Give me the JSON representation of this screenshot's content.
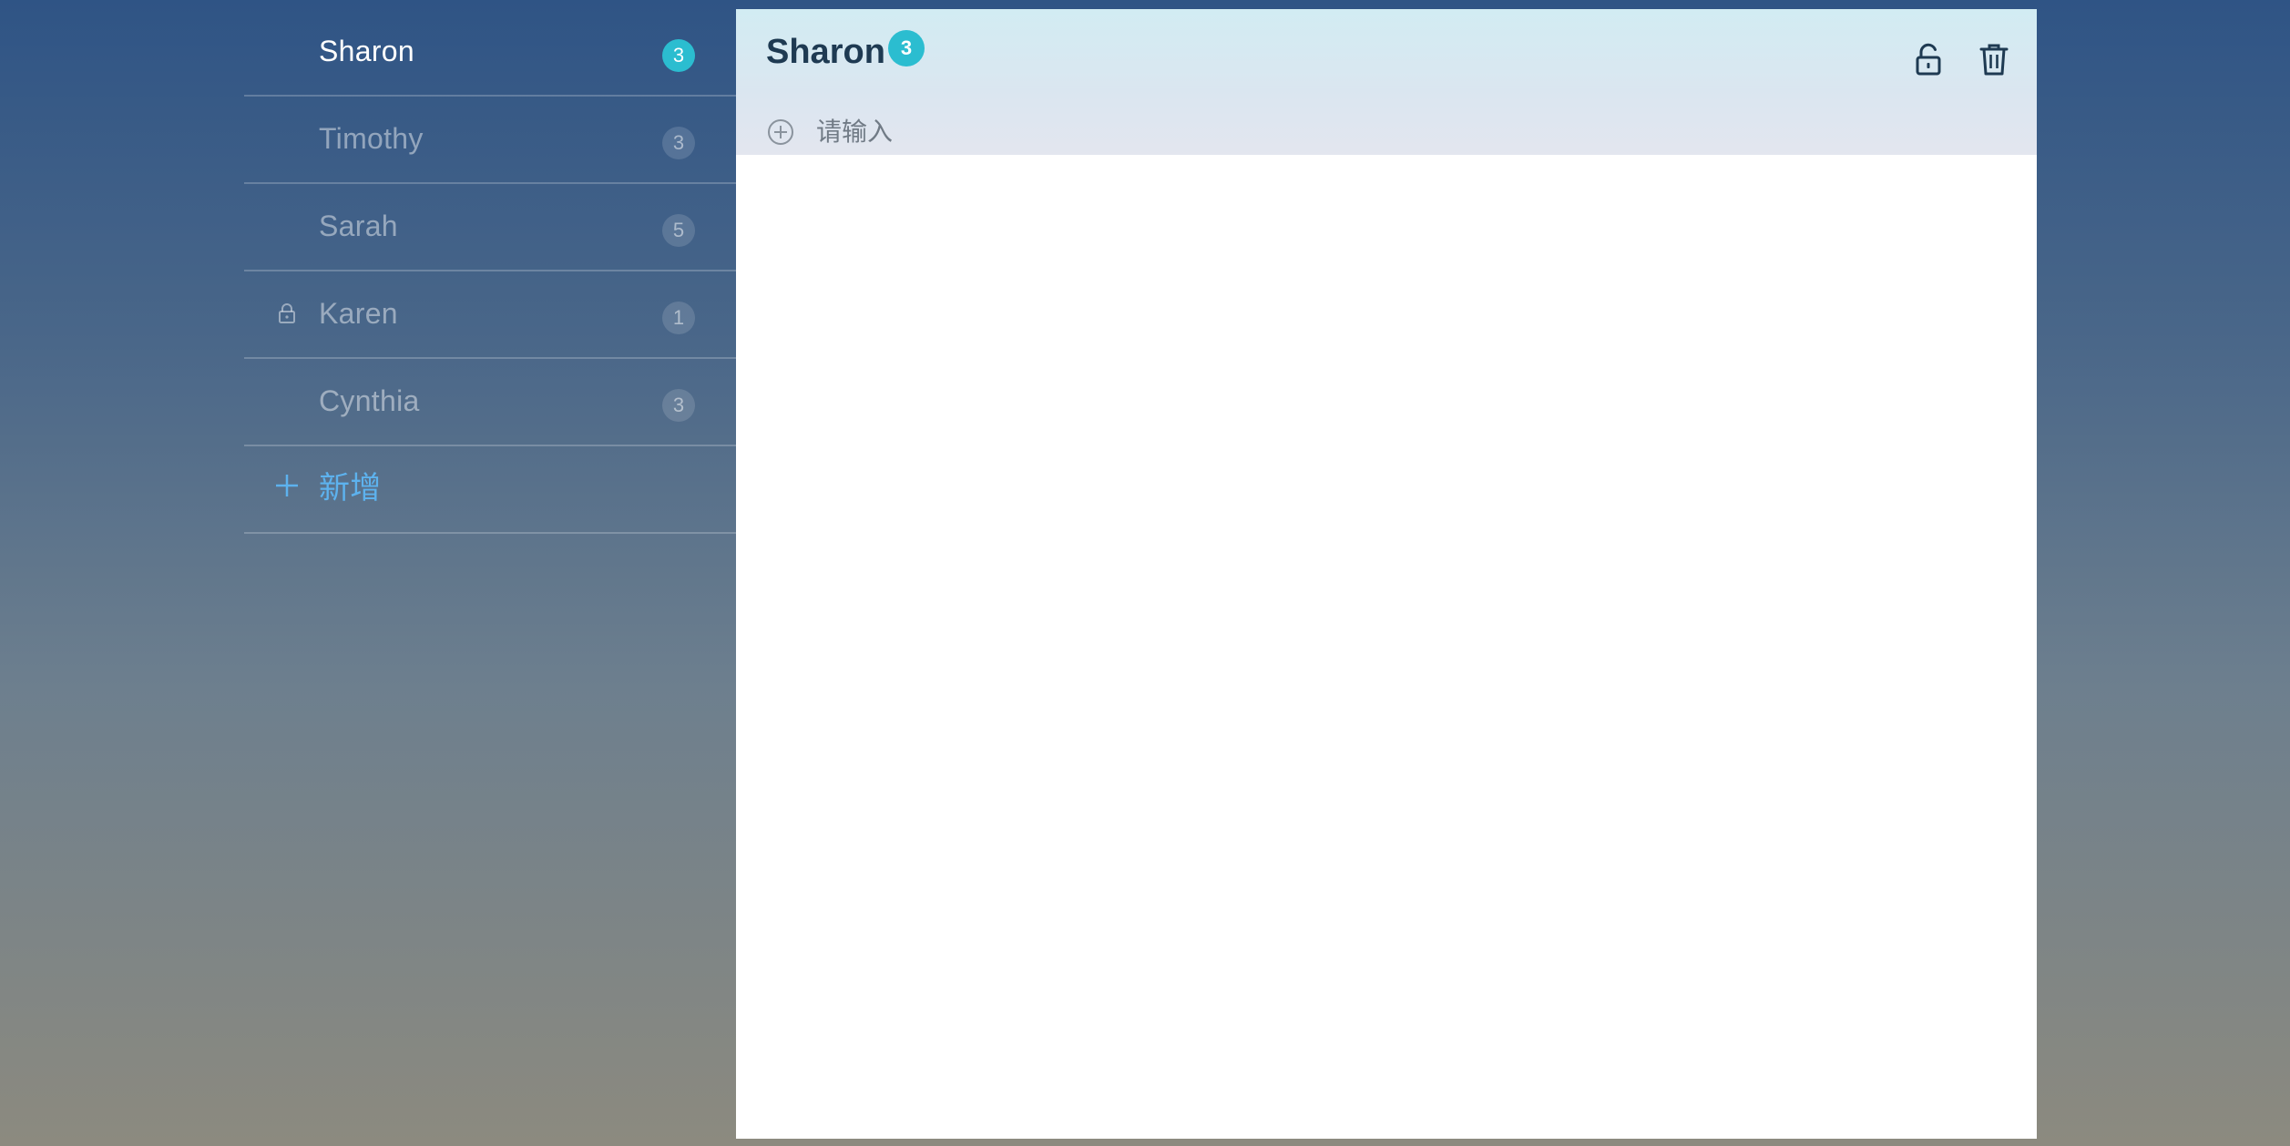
{
  "sidebar": {
    "items": [
      {
        "label": "Sharon",
        "count": "3",
        "active": true,
        "locked": false
      },
      {
        "label": "Timothy",
        "count": "3",
        "active": false,
        "locked": false
      },
      {
        "label": "Sarah",
        "count": "5",
        "active": false,
        "locked": false
      },
      {
        "label": "Karen",
        "count": "1",
        "active": false,
        "locked": true,
        "icon": "lock-icon"
      },
      {
        "label": "Cynthia",
        "count": "3",
        "active": false,
        "locked": false
      }
    ],
    "add_label": "新增",
    "add_icon": "plus-icon"
  },
  "main": {
    "title": "Sharon",
    "count": "3",
    "lock_icon": "unlock-icon",
    "delete_icon": "trash-icon",
    "input": {
      "placeholder": "请输入",
      "value": "",
      "icon": "add-circle-icon"
    }
  },
  "colors": {
    "accent": "#2bbdd0",
    "add_link": "#5db2ee",
    "title_text": "#1e3a52"
  }
}
